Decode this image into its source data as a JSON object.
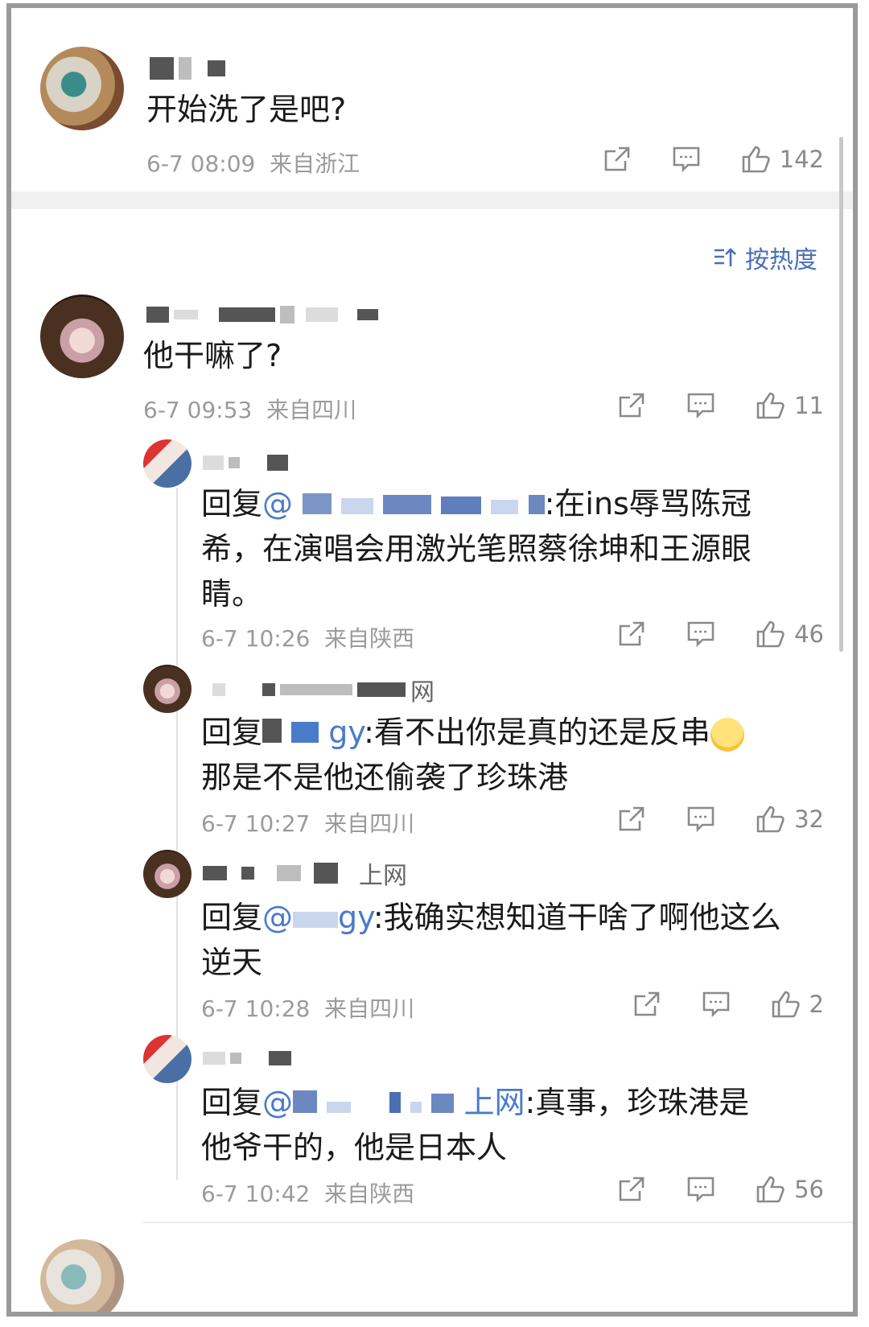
{
  "top_comment": {
    "text": "开始洗了是吧?",
    "timestamp": "6-7 08:09",
    "location": "来自浙江",
    "likes": "142"
  },
  "sort": {
    "label": "按热度"
  },
  "comment": {
    "text": "他干嘛了?",
    "timestamp": "6-7 09:53",
    "location": "来自四川",
    "likes": "11"
  },
  "replies": [
    {
      "prefix": "回复",
      "mention": "@",
      "text_line1": ":在ins辱骂陈冠",
      "text_rest": "希，在演唱会用激光笔照蔡徐坤和王源眼睛。",
      "timestamp": "6-7 10:26",
      "location": "来自陕西",
      "likes": "46"
    },
    {
      "name_suffix": "网",
      "prefix": "回复",
      "mention": "gy",
      "text_line1": ":看不出你是真的还是反串",
      "text_rest": "那是不是他还偷袭了珍珠港",
      "timestamp": "6-7 10:27",
      "location": "来自四川",
      "likes": "32"
    },
    {
      "name_suffix": "上网",
      "prefix": "回复",
      "mention": "@",
      "mention_tail": "gy",
      "text_line1": ":我确实想知道干啥了啊他这么",
      "text_rest": "逆天",
      "timestamp": "6-7 10:28",
      "location": "来自四川",
      "likes": "2"
    },
    {
      "prefix": "回复",
      "mention": "@",
      "mention_tail": "上网",
      "text_line1": ":真事，珍珠港是",
      "text_rest": "他爷干的，他是日本人",
      "timestamp": "6-7 10:42",
      "location": "来自陕西",
      "likes": "56"
    }
  ],
  "icons": [
    "share-icon",
    "comment-icon",
    "like-icon",
    "sort-icon",
    "rolling-eyes-emoji"
  ]
}
